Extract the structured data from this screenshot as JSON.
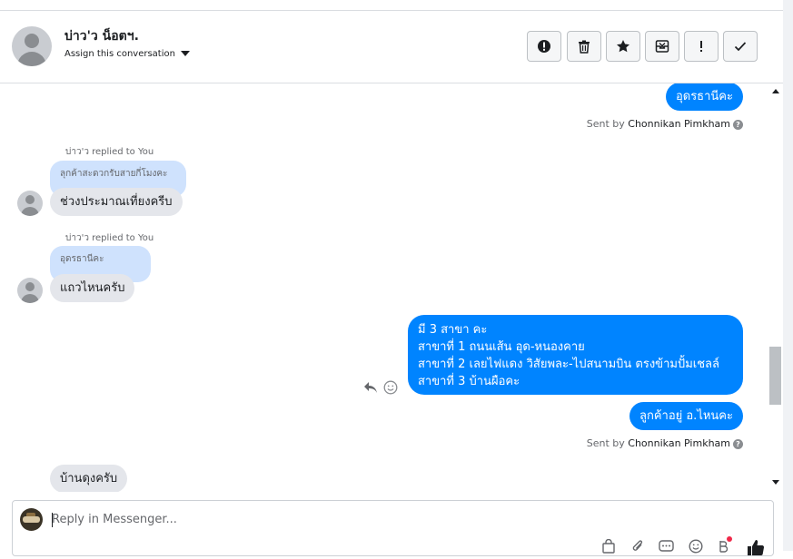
{
  "header": {
    "contact_name": "บ่าว'ว น็อตฯ.",
    "assign_label": "Assign this conversation",
    "actions": [
      "mark-spam",
      "delete",
      "star",
      "archive",
      "follow-up",
      "done"
    ]
  },
  "messages": {
    "out_1": "อุดรธานีคะ",
    "sent_by_prefix": "Sent by ",
    "sender": "Chonnikan Pimkham",
    "replied_1": "บ่าว'ว replied to You",
    "quote_1": "ลุกค้าสะดวกรับสายกี่โมงคะ",
    "in_1": "ช่วงประมาณเที่ยงครีบ",
    "replied_2": "บ่าว'ว replied to You",
    "quote_2": "อุดรธานีคะ",
    "in_2": "แถวไหนครับ",
    "out_multi": [
      "มี 3 สาขา คะ",
      "สาขาที่ 1 ถนนเส้น อุด-หนองคาย",
      "สาขาที่ 2 เลยไฟแดง วิสัยพละ-ไปสนามบิน ตรงข้ามปั้มเชลล์",
      "สาขาที่ 3 บ้านผือคะ"
    ],
    "out_2": "ลูกค้าอยู่ อ.ไหนคะ",
    "in_3": "บ้านดุงครับ"
  },
  "composer": {
    "placeholder": "Reply in Messenger..."
  },
  "colors": {
    "outgoing": "#0084ff",
    "incoming": "#e4e6eb",
    "quote": "#cfe2fd"
  }
}
